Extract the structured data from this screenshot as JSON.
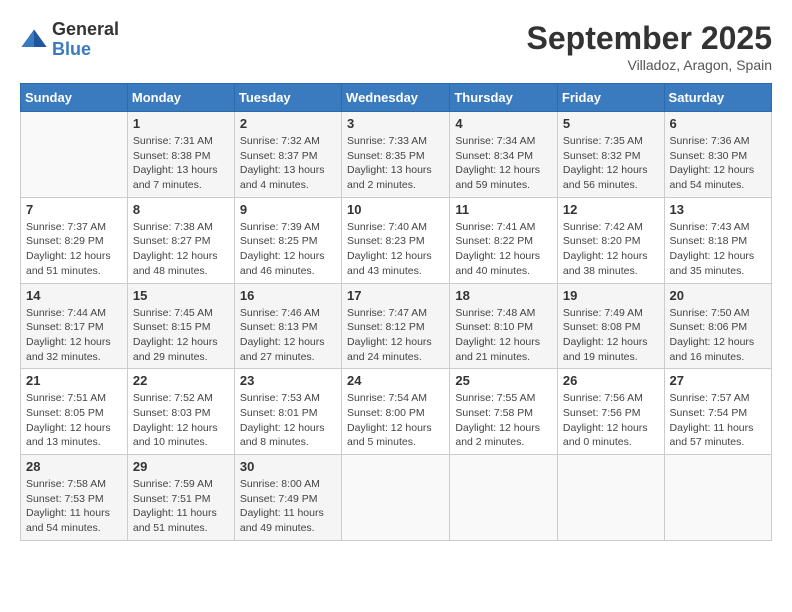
{
  "logo": {
    "general": "General",
    "blue": "Blue"
  },
  "title": "September 2025",
  "location": "Villadoz, Aragon, Spain",
  "days_of_week": [
    "Sunday",
    "Monday",
    "Tuesday",
    "Wednesday",
    "Thursday",
    "Friday",
    "Saturday"
  ],
  "weeks": [
    [
      {
        "day": "",
        "sunrise": "",
        "sunset": "",
        "daylight": "",
        "empty": true
      },
      {
        "day": "1",
        "sunrise": "Sunrise: 7:31 AM",
        "sunset": "Sunset: 8:38 PM",
        "daylight": "Daylight: 13 hours and 7 minutes."
      },
      {
        "day": "2",
        "sunrise": "Sunrise: 7:32 AM",
        "sunset": "Sunset: 8:37 PM",
        "daylight": "Daylight: 13 hours and 4 minutes."
      },
      {
        "day": "3",
        "sunrise": "Sunrise: 7:33 AM",
        "sunset": "Sunset: 8:35 PM",
        "daylight": "Daylight: 13 hours and 2 minutes."
      },
      {
        "day": "4",
        "sunrise": "Sunrise: 7:34 AM",
        "sunset": "Sunset: 8:34 PM",
        "daylight": "Daylight: 12 hours and 59 minutes."
      },
      {
        "day": "5",
        "sunrise": "Sunrise: 7:35 AM",
        "sunset": "Sunset: 8:32 PM",
        "daylight": "Daylight: 12 hours and 56 minutes."
      },
      {
        "day": "6",
        "sunrise": "Sunrise: 7:36 AM",
        "sunset": "Sunset: 8:30 PM",
        "daylight": "Daylight: 12 hours and 54 minutes."
      }
    ],
    [
      {
        "day": "7",
        "sunrise": "Sunrise: 7:37 AM",
        "sunset": "Sunset: 8:29 PM",
        "daylight": "Daylight: 12 hours and 51 minutes."
      },
      {
        "day": "8",
        "sunrise": "Sunrise: 7:38 AM",
        "sunset": "Sunset: 8:27 PM",
        "daylight": "Daylight: 12 hours and 48 minutes."
      },
      {
        "day": "9",
        "sunrise": "Sunrise: 7:39 AM",
        "sunset": "Sunset: 8:25 PM",
        "daylight": "Daylight: 12 hours and 46 minutes."
      },
      {
        "day": "10",
        "sunrise": "Sunrise: 7:40 AM",
        "sunset": "Sunset: 8:23 PM",
        "daylight": "Daylight: 12 hours and 43 minutes."
      },
      {
        "day": "11",
        "sunrise": "Sunrise: 7:41 AM",
        "sunset": "Sunset: 8:22 PM",
        "daylight": "Daylight: 12 hours and 40 minutes."
      },
      {
        "day": "12",
        "sunrise": "Sunrise: 7:42 AM",
        "sunset": "Sunset: 8:20 PM",
        "daylight": "Daylight: 12 hours and 38 minutes."
      },
      {
        "day": "13",
        "sunrise": "Sunrise: 7:43 AM",
        "sunset": "Sunset: 8:18 PM",
        "daylight": "Daylight: 12 hours and 35 minutes."
      }
    ],
    [
      {
        "day": "14",
        "sunrise": "Sunrise: 7:44 AM",
        "sunset": "Sunset: 8:17 PM",
        "daylight": "Daylight: 12 hours and 32 minutes."
      },
      {
        "day": "15",
        "sunrise": "Sunrise: 7:45 AM",
        "sunset": "Sunset: 8:15 PM",
        "daylight": "Daylight: 12 hours and 29 minutes."
      },
      {
        "day": "16",
        "sunrise": "Sunrise: 7:46 AM",
        "sunset": "Sunset: 8:13 PM",
        "daylight": "Daylight: 12 hours and 27 minutes."
      },
      {
        "day": "17",
        "sunrise": "Sunrise: 7:47 AM",
        "sunset": "Sunset: 8:12 PM",
        "daylight": "Daylight: 12 hours and 24 minutes."
      },
      {
        "day": "18",
        "sunrise": "Sunrise: 7:48 AM",
        "sunset": "Sunset: 8:10 PM",
        "daylight": "Daylight: 12 hours and 21 minutes."
      },
      {
        "day": "19",
        "sunrise": "Sunrise: 7:49 AM",
        "sunset": "Sunset: 8:08 PM",
        "daylight": "Daylight: 12 hours and 19 minutes."
      },
      {
        "day": "20",
        "sunrise": "Sunrise: 7:50 AM",
        "sunset": "Sunset: 8:06 PM",
        "daylight": "Daylight: 12 hours and 16 minutes."
      }
    ],
    [
      {
        "day": "21",
        "sunrise": "Sunrise: 7:51 AM",
        "sunset": "Sunset: 8:05 PM",
        "daylight": "Daylight: 12 hours and 13 minutes."
      },
      {
        "day": "22",
        "sunrise": "Sunrise: 7:52 AM",
        "sunset": "Sunset: 8:03 PM",
        "daylight": "Daylight: 12 hours and 10 minutes."
      },
      {
        "day": "23",
        "sunrise": "Sunrise: 7:53 AM",
        "sunset": "Sunset: 8:01 PM",
        "daylight": "Daylight: 12 hours and 8 minutes."
      },
      {
        "day": "24",
        "sunrise": "Sunrise: 7:54 AM",
        "sunset": "Sunset: 8:00 PM",
        "daylight": "Daylight: 12 hours and 5 minutes."
      },
      {
        "day": "25",
        "sunrise": "Sunrise: 7:55 AM",
        "sunset": "Sunset: 7:58 PM",
        "daylight": "Daylight: 12 hours and 2 minutes."
      },
      {
        "day": "26",
        "sunrise": "Sunrise: 7:56 AM",
        "sunset": "Sunset: 7:56 PM",
        "daylight": "Daylight: 12 hours and 0 minutes."
      },
      {
        "day": "27",
        "sunrise": "Sunrise: 7:57 AM",
        "sunset": "Sunset: 7:54 PM",
        "daylight": "Daylight: 11 hours and 57 minutes."
      }
    ],
    [
      {
        "day": "28",
        "sunrise": "Sunrise: 7:58 AM",
        "sunset": "Sunset: 7:53 PM",
        "daylight": "Daylight: 11 hours and 54 minutes."
      },
      {
        "day": "29",
        "sunrise": "Sunrise: 7:59 AM",
        "sunset": "Sunset: 7:51 PM",
        "daylight": "Daylight: 11 hours and 51 minutes."
      },
      {
        "day": "30",
        "sunrise": "Sunrise: 8:00 AM",
        "sunset": "Sunset: 7:49 PM",
        "daylight": "Daylight: 11 hours and 49 minutes."
      },
      {
        "day": "",
        "sunrise": "",
        "sunset": "",
        "daylight": "",
        "empty": true
      },
      {
        "day": "",
        "sunrise": "",
        "sunset": "",
        "daylight": "",
        "empty": true
      },
      {
        "day": "",
        "sunrise": "",
        "sunset": "",
        "daylight": "",
        "empty": true
      },
      {
        "day": "",
        "sunrise": "",
        "sunset": "",
        "daylight": "",
        "empty": true
      }
    ]
  ]
}
